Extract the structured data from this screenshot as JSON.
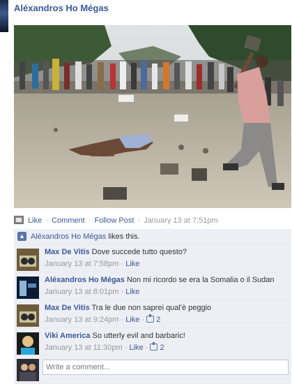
{
  "post": {
    "author": "Aléxandros Ho Mégas"
  },
  "actions": {
    "like": "Like",
    "comment": "Comment",
    "follow": "Follow Post",
    "timestamp": "January 13 at 7:51pm",
    "sep": "·"
  },
  "likes": {
    "who": "Aléxandros Ho Mégas",
    "suffix": " likes this."
  },
  "comments": [
    {
      "name": "Max De Vitis",
      "text": "Dove succede tutto questo?",
      "time": "January 13 at 7:58pm",
      "like": "Like",
      "like_count": ""
    },
    {
      "name": "Aléxandros Ho Mégas",
      "text": "Non mi ricordo se era la Somalia o il Sudan",
      "time": "January 13 at 8:01pm",
      "like": "Like",
      "like_count": ""
    },
    {
      "name": "Max De Vitis",
      "text": "Tra le due non saprei qual'è peggio",
      "time": "January 13 at 9:24pm",
      "like": "Like",
      "like_count": "2"
    },
    {
      "name": "Viki America",
      "text": "So utterly evil and barbaric!",
      "time": "January 13 at 11:30pm",
      "like": "Like",
      "like_count": "2"
    }
  ],
  "reply": {
    "placeholder": "Write a comment..."
  },
  "colors": {
    "link": "#3b5998",
    "ufi_bg": "#edeff4",
    "meta": "#999999"
  }
}
